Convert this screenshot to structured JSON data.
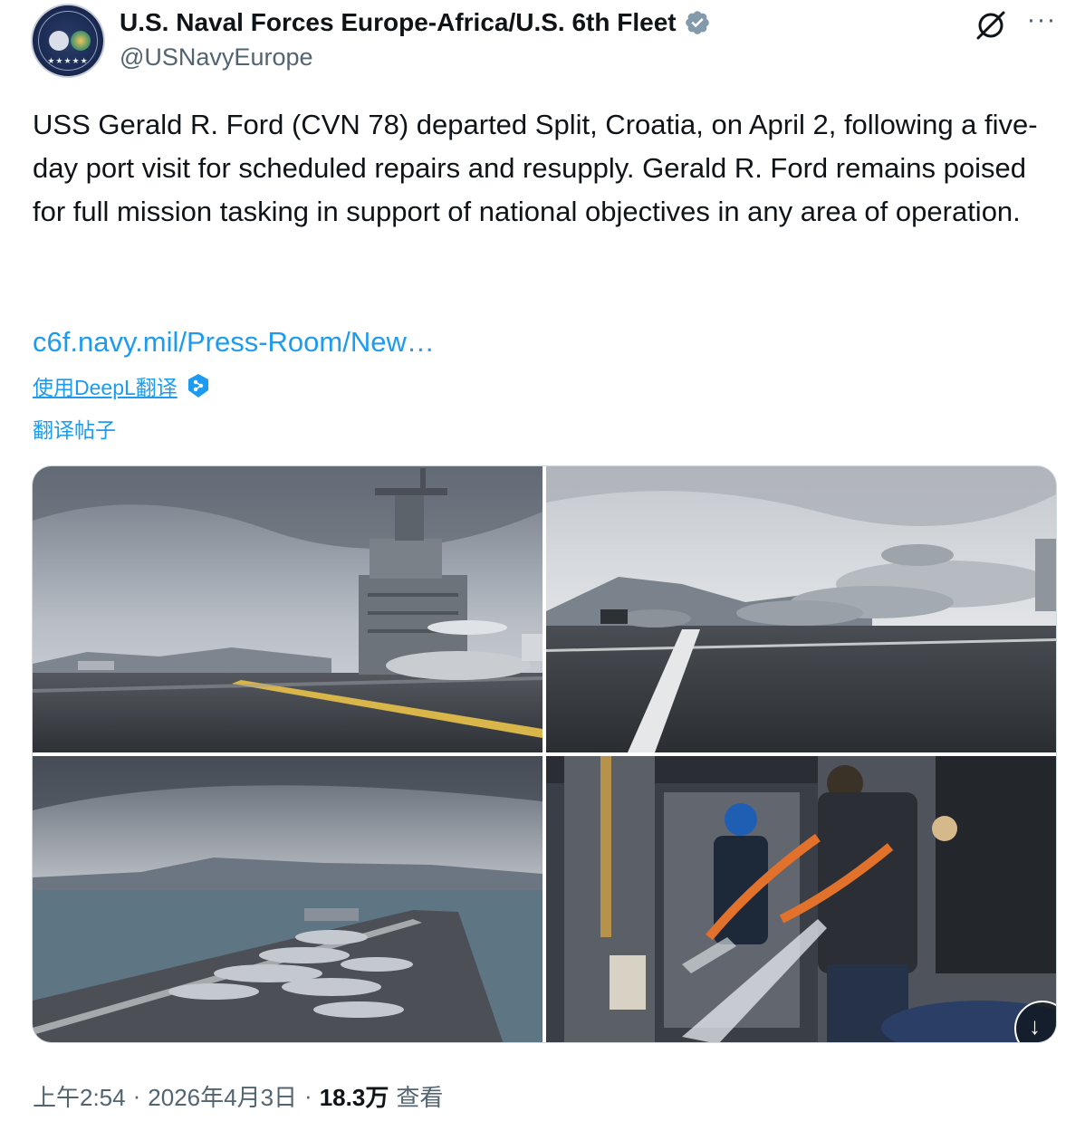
{
  "author": {
    "display_name": "U.S. Naval Forces Europe-Africa/U.S. 6th Fleet",
    "handle": "@USNavyEurope",
    "verified_icon": "verified-badge-icon",
    "avatar_icon": "navy-seal-logo",
    "avatar_text": "U.S. NAVAL FORCES EUROPE AFRICA"
  },
  "header_actions": {
    "grok_icon": "grok-icon",
    "more_icon": "more-options-icon",
    "more_label": "···"
  },
  "tweet": {
    "text": "USS Gerald R. Ford (CVN 78) departed Split, Croatia, on April 2, following a five-day port visit for scheduled repairs and resupply. Gerald R. Ford remains poised for full mission tasking in support of national objectives in any area of operation.",
    "link": "c6f.navy.mil/Press-Room/New…"
  },
  "translation": {
    "deepl_label": "使用DeepL翻译",
    "translate_post_label": "翻译帖子"
  },
  "media": {
    "photos": [
      {
        "alt": "aircraft carrier island and flight deck"
      },
      {
        "alt": "fighter jets parked on flight deck"
      },
      {
        "alt": "carrier deck from above with sea and mountains"
      },
      {
        "alt": "sailors spraying fire hose in hangar bay"
      }
    ],
    "download_icon": "download-icon",
    "download_label": "↓"
  },
  "footer": {
    "time": "上午2:54",
    "date": "2026年4月3日",
    "views_count": "18.3万",
    "views_label": "查看",
    "separator": "·"
  },
  "colors": {
    "link": "#1d9bf0",
    "secondary_text": "#536471",
    "primary_text": "#0f1419",
    "verified": "#829aab"
  }
}
